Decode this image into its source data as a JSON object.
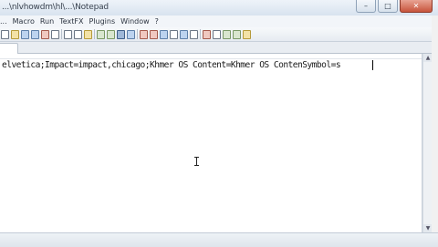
{
  "window": {
    "title": "...\\nlvhowdm\\hl\\...\\Notepad",
    "controls": {
      "minimize": "–",
      "maximize": "□",
      "close": "✕"
    }
  },
  "menu": {
    "items": [
      "...",
      "Macro",
      "Run",
      "TextFX",
      "Plugins",
      "Window",
      "?"
    ]
  },
  "toolbar": {
    "icons": [
      "new-icon",
      "open-icon",
      "save-icon",
      "save-all-icon",
      "close-icon",
      "print-icon",
      "cut-icon",
      "copy-icon",
      "paste-icon",
      "undo-icon",
      "redo-icon",
      "find-icon",
      "replace-icon",
      "zoom-in-icon",
      "zoom-out-icon",
      "sync-icon",
      "wrap-icon",
      "indent-icon",
      "show-all-icon",
      "macro-record-icon",
      "macro-stop-icon",
      "macro-play-icon",
      "macro-run-icon",
      "macro-save-icon"
    ]
  },
  "editor": {
    "line": "elvetica;Impact=impact,chicago;Khmer OS Content=Khmer OS ContenSymbol=s"
  },
  "colors": {
    "title_bar": "#dfe8f2",
    "editor_bg": "#ffffff",
    "close_button": "#c7543b"
  }
}
